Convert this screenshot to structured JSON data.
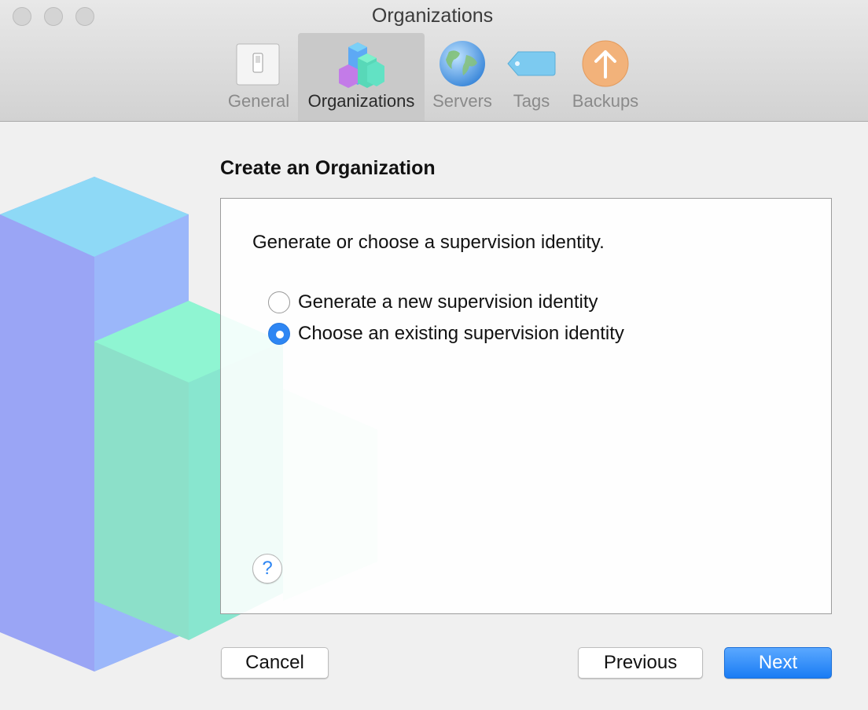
{
  "window": {
    "title": "Organizations"
  },
  "toolbar": {
    "tabs": [
      {
        "label": "General",
        "icon": "switch-icon",
        "selected": false
      },
      {
        "label": "Organizations",
        "icon": "blocks-icon",
        "selected": true
      },
      {
        "label": "Servers",
        "icon": "globe-icon",
        "selected": false
      },
      {
        "label": "Tags",
        "icon": "tag-icon",
        "selected": false
      },
      {
        "label": "Backups",
        "icon": "upload-arrow-icon",
        "selected": false
      }
    ]
  },
  "main": {
    "heading": "Create an Organization",
    "prompt": "Generate or choose a supervision identity.",
    "options": [
      {
        "label": "Generate a new supervision identity",
        "selected": false
      },
      {
        "label": "Choose an existing supervision identity",
        "selected": true
      }
    ],
    "help_label": "?"
  },
  "buttons": {
    "cancel": "Cancel",
    "previous": "Previous",
    "next": "Next"
  },
  "colors": {
    "accent": "#2e86f3"
  }
}
